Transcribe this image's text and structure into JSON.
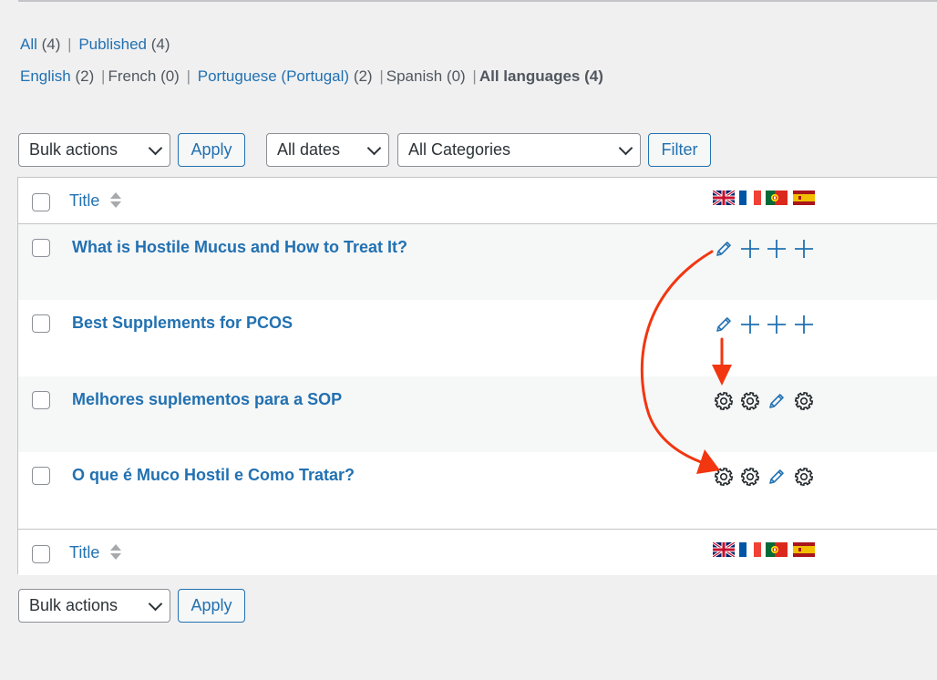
{
  "subsubsub_status": {
    "all_label": "All",
    "all_count": "(4)",
    "published_label": "Published",
    "published_count": "(4)",
    "separator": "|"
  },
  "subsubsub_language": {
    "english_label": "English",
    "english_count": "(2)",
    "french": "French (0)",
    "portuguese_label": "Portuguese (Portugal)",
    "portuguese_count": "(2)",
    "spanish": "Spanish (0)",
    "all_languages": "All languages (4)",
    "separator": "|"
  },
  "toolbar_top": {
    "bulk_actions": "Bulk actions",
    "apply": "Apply",
    "dates": "All dates",
    "categories": "All Categories",
    "filter": "Filter"
  },
  "table": {
    "header_title": "Title",
    "footer_title": "Title",
    "language_flags": [
      "flag-uk-icon",
      "flag-france-icon",
      "flag-portugal-icon",
      "flag-spain-icon"
    ],
    "rows": [
      {
        "title": "What is Hostile Mucus and How to Treat It?",
        "actions": [
          "edit",
          "add",
          "add",
          "add"
        ]
      },
      {
        "title": "Best Supplements for PCOS",
        "actions": [
          "edit",
          "add",
          "add",
          "add"
        ]
      },
      {
        "title": "Melhores suplementos para a SOP",
        "actions": [
          "settings",
          "settings",
          "edit",
          "settings"
        ]
      },
      {
        "title": "O que é Muco Hostil e Como Tratar?",
        "actions": [
          "settings",
          "settings",
          "edit",
          "settings"
        ]
      }
    ]
  },
  "toolbar_bottom": {
    "bulk_actions": "Bulk actions",
    "apply": "Apply"
  },
  "colors": {
    "link": "#2271b1",
    "annotation_red": "#f2360f",
    "background": "#f0f0f1"
  }
}
